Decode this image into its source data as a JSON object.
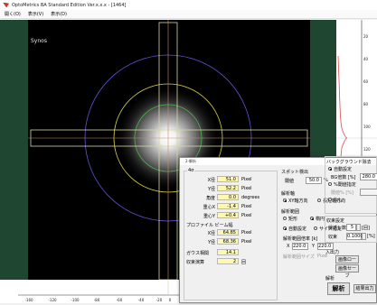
{
  "window": {
    "title": "OptoMetrics BA Standard Edition Ver.x.x.x - [1464]"
  },
  "menu": [
    "開く(O)",
    "表示(V)",
    "表示(D)"
  ],
  "canvas": {
    "label": "Synos"
  },
  "bottom_axis": {
    "ticks": [
      "-160",
      "-120",
      "-100",
      "-80",
      "-60",
      "-40",
      "-20",
      "0"
    ]
  },
  "right_axis": {
    "ticks": [
      "20",
      "40",
      "60",
      "80",
      "100",
      "120",
      "140",
      "160"
    ]
  },
  "dialog": {
    "title": "2-解析",
    "group_main": "4σ",
    "rows": [
      {
        "label": "X径",
        "value": "51.0",
        "unit": "Pixel"
      },
      {
        "label": "Y径",
        "value": "52.2",
        "unit": "Pixel"
      },
      {
        "label": "角度",
        "value": "0.0",
        "unit": "degrees"
      },
      {
        "label": "重心X",
        "value": "-1.4",
        "unit": "Pixel"
      },
      {
        "label": "重心Y",
        "value": "+0.4",
        "unit": "Pixel"
      }
    ],
    "group_profile": "プロファイル ビーム幅",
    "profile_rows": [
      {
        "label": "X径",
        "value": "64.85",
        "unit": "Pixel"
      },
      {
        "label": "Y径",
        "value": "68.36",
        "unit": "Pixel"
      }
    ],
    "gauss_label": "ガウス相関",
    "gauss_value": "14.1",
    "convergence_label": "収束演算",
    "convergence_value": "2",
    "convergence_unit": "回",
    "spot": {
      "title": "スポット検出",
      "threshold_label": "閾値",
      "threshold_value": "50.0",
      "threshold_unit": "%",
      "axis_title": "解析軸",
      "axis_opt1": "XY軸方向",
      "axis_opt2": "長短軸方向",
      "range_title": "解析範囲",
      "range_opt1": "矩形",
      "range_opt2": "楕円",
      "auto_opt": "自動設定",
      "size_opt": "サイズ指定",
      "mult_title": "解析範囲倍率 [k]",
      "mult_x_label": "X",
      "mult_x": "220.0",
      "mult_y_label": "Y",
      "mult_y": "220.0",
      "size_title": "解析範囲サイズ",
      "size_unit": "Pixel"
    },
    "bg": {
      "title": "バックグラウンド除去",
      "opt_auto": "自動設定",
      "bg_ratio_label": "BG倍数 [%]",
      "bg_ratio": "280.0",
      "opt_percent": "%閾値指定",
      "bg_percent_label": "閾値% [%]",
      "opt_none": "なし"
    },
    "convergence": {
      "title": "収束設定",
      "repeat_label": "繰返し数",
      "repeat_value": "5",
      "repeat_unit": "[回]",
      "conv_label": "収束",
      "conv_value": "0.1000",
      "conv_unit": "[%]"
    },
    "io": {
      "title": "入出力",
      "load": "画像ロード",
      "save": "画像セーブ"
    },
    "analysis": {
      "title": "解析",
      "run": "解析",
      "output": "結果出力"
    }
  }
}
